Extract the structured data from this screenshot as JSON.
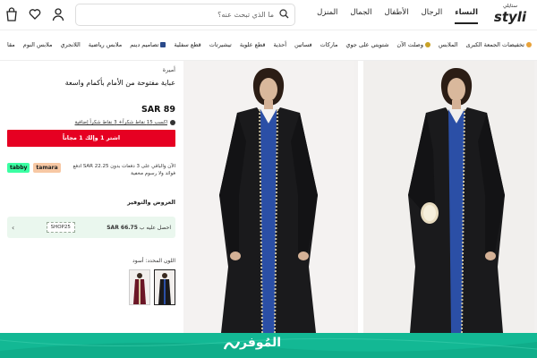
{
  "header": {
    "logo_ar": "ستايلي",
    "logo_en": "styli",
    "nav": [
      "النساء",
      "الرجال",
      "الأطفال",
      "الجمال",
      "المنزل"
    ],
    "search_placeholder": "ما الذي تبحث عنه؟",
    "icons": [
      "bag-icon",
      "heart-icon",
      "user-icon",
      "search-icon"
    ]
  },
  "categories": [
    "تخفيضات الجمعة الكبرى",
    "الملابس",
    "وصلت الآن",
    "شتويتي على جوي",
    "ماركات",
    "فساتين",
    "أحذية",
    "قطع علوية",
    "تيشيرتات",
    "قطع سفلية",
    "تصاميم دينم",
    "ملابس رياضية",
    "اللانجري",
    "ملابس النوم",
    "مقا"
  ],
  "product": {
    "brand": "أميرة",
    "title": "عباية مفتوحة من الأمام بأكمام واسعة",
    "price": "SAR 89",
    "points_text": "اكسب 15 نقاط شكراً+ 3 نقاط شكراً إضافية",
    "buy_button": "اشتر 1 وإلك 1 مجاناً",
    "installment_text": "ادفع SAR 22.25 الآن والباقي على 3 دفعات بدون فوائد ولا رسوم مخفية",
    "tabby_label": "tabby",
    "tamara_label": "tamara",
    "offers_heading": "العروض والتوفير",
    "coupon_text_prefix": "احصل عليه ب",
    "coupon_price": "SAR 66.75",
    "coupon_code": "SHOP25",
    "color_label": "اللون المحدد: أسود"
  },
  "watermark": {
    "text": "المُوفر"
  },
  "colors": {
    "buy": "#e60022",
    "watermark_bg": "#13b894",
    "tabby": "#3bffa3",
    "tamara": "#f7c8a4",
    "coupon_bg": "#eaf7ee"
  }
}
